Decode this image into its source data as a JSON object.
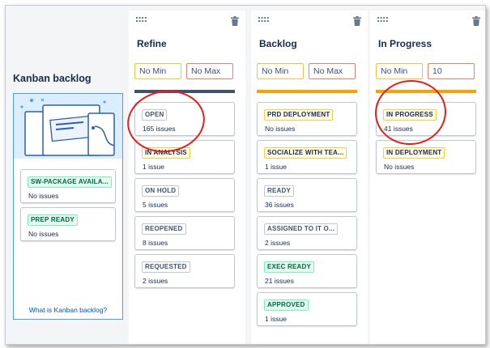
{
  "sidebar": {
    "title": "Kanban backlog",
    "cards": [
      {
        "status": "SW-PACKAGE AVAILA...",
        "count": "No issues",
        "style": "green"
      },
      {
        "status": "PREP READY",
        "count": "No issues",
        "style": "green"
      }
    ],
    "help_link": "What is Kanban backlog?"
  },
  "columns": [
    {
      "title": "Refine",
      "min": "No Min",
      "max": "No Max",
      "bar_color": "#42526e",
      "cards": [
        {
          "status": "OPEN",
          "count": "165 issues",
          "style": "gray"
        },
        {
          "status": "IN ANALYSIS",
          "count": "1 issue",
          "style": "yellow"
        },
        {
          "status": "ON HOLD",
          "count": "5 issues",
          "style": "gray"
        },
        {
          "status": "REOPENED",
          "count": "8 issues",
          "style": "gray"
        },
        {
          "status": "REQUESTED",
          "count": "2 issues",
          "style": "gray"
        }
      ]
    },
    {
      "title": "Backlog",
      "min": "No Min",
      "max": "No Max",
      "bar_color": "#f4a300",
      "cards": [
        {
          "status": "PRD DEPLOYMENT",
          "count": "No issues",
          "style": "yellow"
        },
        {
          "status": "SOCIALIZE WITH TEA...",
          "count": "1 issue",
          "style": "yellow"
        },
        {
          "status": "READY",
          "count": "36 issues",
          "style": "gray"
        },
        {
          "status": "ASSIGNED TO IT O...",
          "count": "2 issues",
          "style": "gray"
        },
        {
          "status": "EXEC READY",
          "count": "21 issues",
          "style": "green"
        },
        {
          "status": "APPROVED",
          "count": "1 issue",
          "style": "green"
        }
      ]
    },
    {
      "title": "In Progress",
      "min": "No Min",
      "max": "10",
      "bar_color": "#f4a300",
      "cards": [
        {
          "status": "IN PROGRESS",
          "count": "41 issues",
          "style": "yellow"
        },
        {
          "status": "IN DEPLOYMENT",
          "count": "No issues",
          "style": "yellow"
        }
      ]
    }
  ],
  "icons": {
    "drag_handle": "drag-handle-icon",
    "delete": "trash-icon"
  },
  "colors": {
    "annotation": "#e02020",
    "link": "#0052cc"
  }
}
